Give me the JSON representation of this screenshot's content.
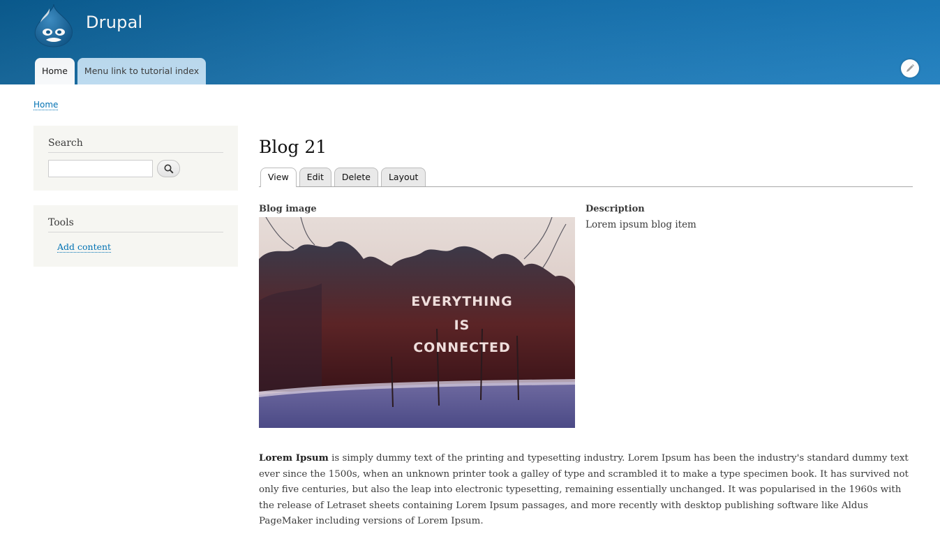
{
  "header": {
    "site_name": "Drupal",
    "menu": [
      {
        "label": "Home",
        "active": true
      },
      {
        "label": "Menu link to tutorial index",
        "active": false
      }
    ],
    "edit_icon": "pencil-icon"
  },
  "breadcrumb": {
    "home": "Home"
  },
  "sidebar": {
    "search": {
      "title": "Search",
      "placeholder": "",
      "value": "",
      "button_icon": "search-icon"
    },
    "tools": {
      "title": "Tools",
      "link": "Add content"
    }
  },
  "content": {
    "title": "Blog 21",
    "tabs": [
      {
        "label": "View",
        "active": true
      },
      {
        "label": "Edit",
        "active": false
      },
      {
        "label": "Delete",
        "active": false
      },
      {
        "label": "Layout",
        "active": false
      }
    ],
    "image_label": "Blog image",
    "image_text": [
      "EVERYTHING",
      "IS",
      "CONNECTED"
    ],
    "description_label": "Description",
    "description_value": "Lorem ipsum blog item",
    "body_strong": "Lorem Ipsum",
    "body_text": " is simply dummy text of the printing and typesetting industry. Lorem Ipsum has been the industry's standard dummy text ever since the 1500s, when an unknown printer took a galley of type and scrambled it to make a type specimen book. It has survived not only five centuries, but also the leap into electronic typesetting, remaining essentially unchanged. It was popularised in the 1960s with the release of Letraset sheets containing Lorem Ipsum passages, and more recently with desktop publishing software like Aldus PageMaker including versions of Lorem Ipsum."
  },
  "colors": {
    "header_dark": "#0a5d92",
    "header_light": "#1b7cbd",
    "link": "#0071b3",
    "sidebar_bg": "#f6f6f2"
  }
}
